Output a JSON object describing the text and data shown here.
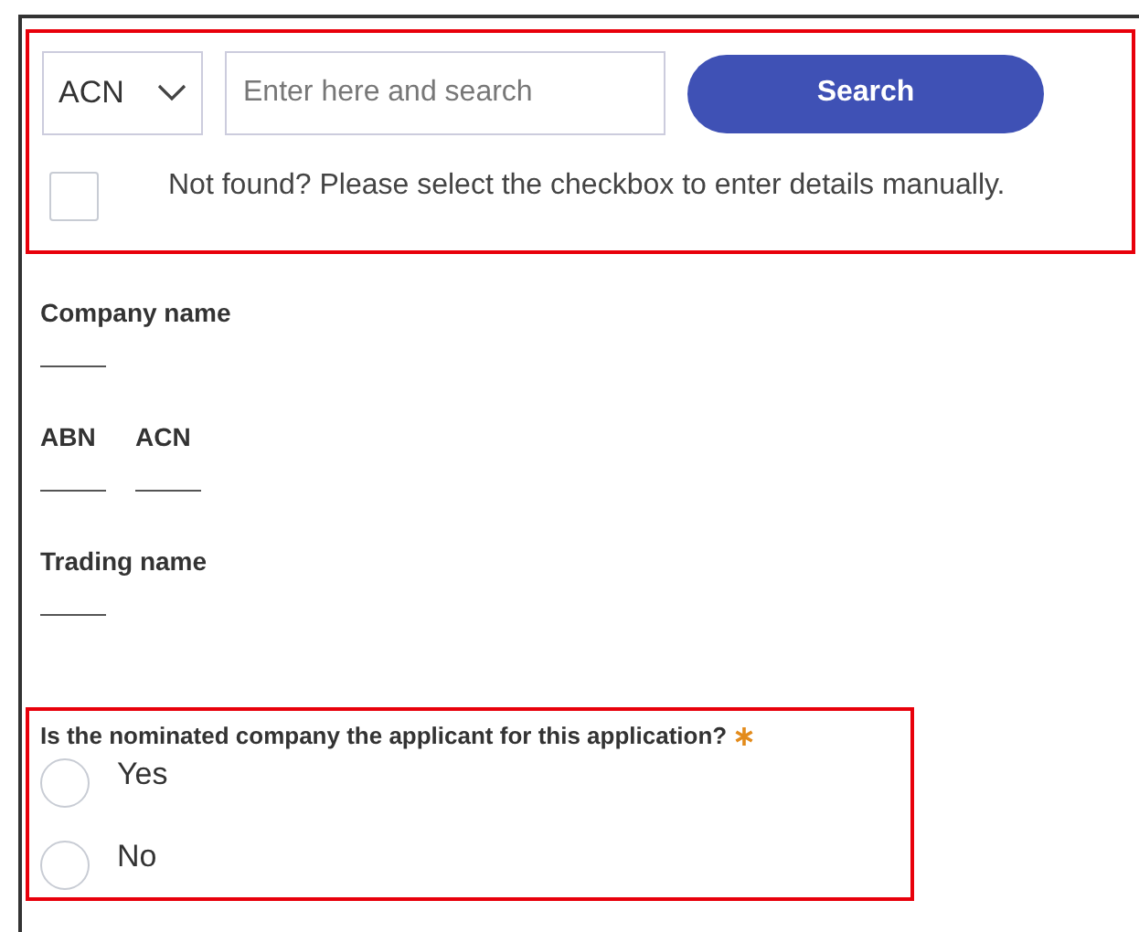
{
  "search_section": {
    "highlighted": true,
    "id_type": {
      "value": "ACN"
    },
    "search_field": {
      "placeholder": "Enter here and search"
    },
    "search_button": "Search",
    "manual_entry": {
      "checked": false,
      "label": "Not found? Please select the checkbox to enter details manually."
    }
  },
  "field_rows": [
    [
      {
        "label": "Company name"
      }
    ],
    [
      {
        "label": "ABN"
      },
      {
        "label": "ACN"
      }
    ],
    [
      {
        "label": "Trading name"
      }
    ]
  ],
  "question": {
    "highlighted": true,
    "text": "Is the nominated company the applicant for this application?",
    "required": true,
    "options": [
      {
        "label": "Yes",
        "selected": false
      },
      {
        "label": "No",
        "selected": false
      }
    ]
  }
}
